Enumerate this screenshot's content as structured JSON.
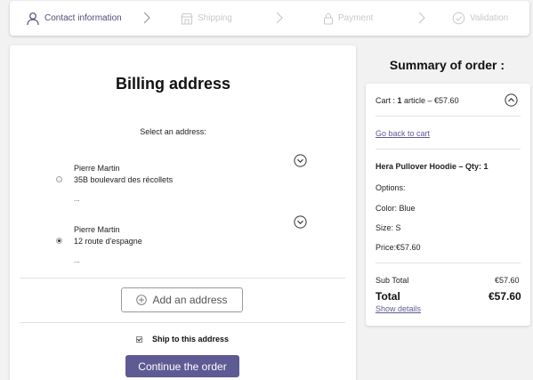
{
  "stepper": {
    "steps": [
      {
        "label": "Contact information",
        "icon": "user-icon",
        "state": "active"
      },
      {
        "label": "Shipping",
        "icon": "store-icon",
        "state": "inactive"
      },
      {
        "label": "Payment",
        "icon": "lock-icon",
        "state": "inactive"
      },
      {
        "label": "Validation",
        "icon": "check-circle-icon",
        "state": "inactive"
      }
    ]
  },
  "billing": {
    "title": "Billing address",
    "select_label": "Select an address:",
    "addresses": [
      {
        "name": "Pierre Martin",
        "street": "35B boulevard des récollets",
        "extra": "...",
        "selected": false
      },
      {
        "name": "Pierre Martin",
        "street": "12 route d'espagne",
        "extra": "...",
        "selected": true
      }
    ],
    "add_address_label": "Add an address",
    "ship_to_label": "Ship to this address",
    "ship_to_checked": true,
    "continue_label": "Continue the order"
  },
  "summary": {
    "title": "Summary of order :",
    "cart_prefix": "Cart : ",
    "cart_count": "1",
    "cart_suffix": " article – €57.60",
    "back_link": "Go back to cart",
    "item_title": "Hera Pullover Hoodie – Qty: 1",
    "options_label": "Options:",
    "color_line": "Color: Blue",
    "size_line": "Size: S",
    "price_line": "Price:€57.60",
    "subtotal_label": "Sub Total",
    "subtotal_value": "€57.60",
    "total_label": "Total",
    "total_value": "€57.60",
    "details_link": "Show details"
  },
  "colors": {
    "accent": "#5e5a94",
    "active_step": "#4d4d7a",
    "inactive_step": "#c9c9c9"
  }
}
